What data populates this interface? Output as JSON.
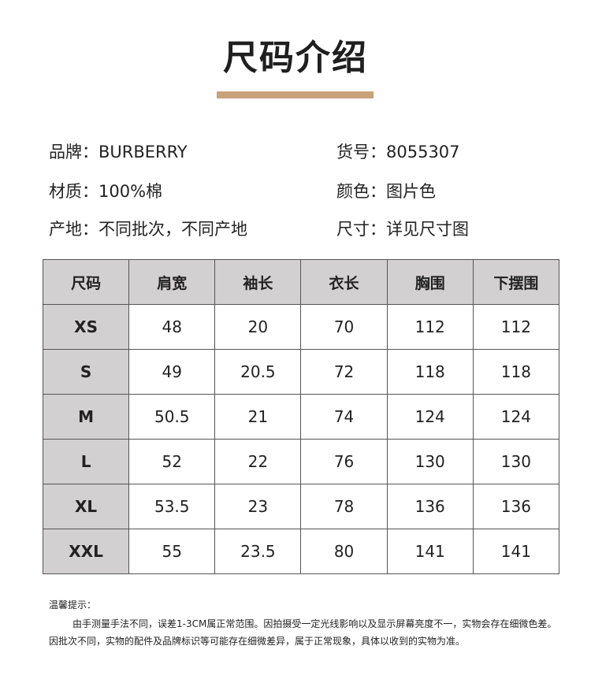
{
  "title": "尺码介绍",
  "info": {
    "brand": "品牌：BURBERRY",
    "item_no": "货号：8055307",
    "material": "材质：100%棉",
    "color": "颜色：图片色",
    "origin": "产地：不同批次，不同产地",
    "size": "尺寸：详见尺寸图"
  },
  "table": {
    "headers": [
      "尺码",
      "肩宽",
      "袖长",
      "衣长",
      "胸围",
      "下摆围"
    ],
    "rows": [
      [
        "XS",
        "48",
        "20",
        "70",
        "112",
        "112"
      ],
      [
        "S",
        "49",
        "20.5",
        "72",
        "118",
        "118"
      ],
      [
        "M",
        "50.5",
        "21",
        "74",
        "124",
        "124"
      ],
      [
        "L",
        "52",
        "22",
        "76",
        "130",
        "130"
      ],
      [
        "XL",
        "53.5",
        "23",
        "78",
        "136",
        "136"
      ],
      [
        "XXL",
        "55",
        "23.5",
        "80",
        "141",
        "141"
      ]
    ]
  },
  "notes": {
    "heading": "温馨提示：",
    "line1": "由手测量手法不同，误差1-3CM属正常范围。因拍摄受一定光线影响以及显示屏幕亮度不一，实物会存在细微色差。",
    "line2": "因批次不同，实物的配件及品牌标识等可能存在细微差异，属于正常现象，具体以收到的实物为准。"
  },
  "colors": {
    "accent_bar": "#c9a27a",
    "header_bg": "#d3d0d1"
  }
}
